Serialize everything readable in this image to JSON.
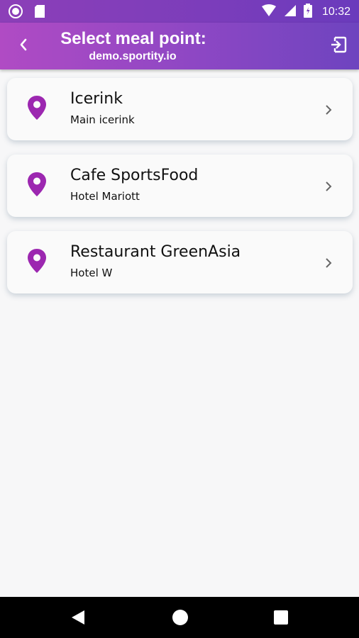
{
  "status_bar": {
    "time": "10:32"
  },
  "app_bar": {
    "title": "Select meal point:",
    "subtitle": "demo.sportity.io",
    "back_icon": "chevron-left-icon",
    "logout_icon": "logout-icon"
  },
  "colors": {
    "accent": "#9c27b0",
    "appbar_start": "#b04bc4",
    "appbar_end": "#6e44bf"
  },
  "meal_points": [
    {
      "name": "Icerink",
      "location": "Main icerink"
    },
    {
      "name": "Cafe SportsFood",
      "location": "Hotel Mariott"
    },
    {
      "name": "Restaurant GreenAsia",
      "location": "Hotel W"
    }
  ]
}
